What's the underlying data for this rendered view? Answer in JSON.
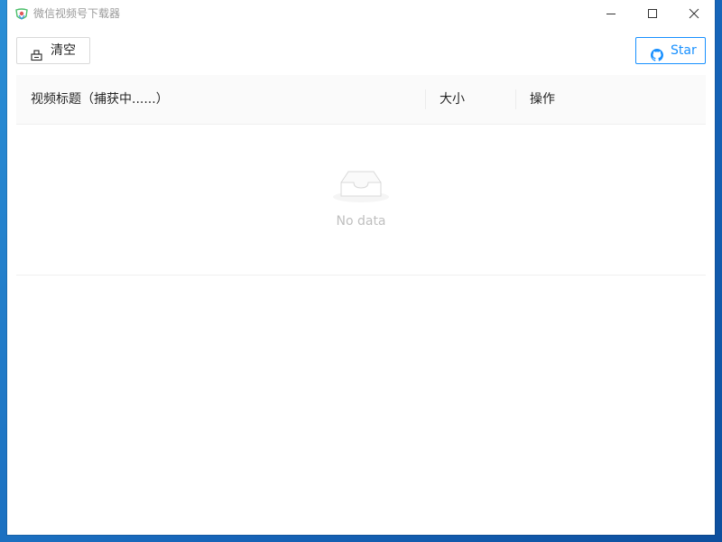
{
  "window": {
    "title": "微信视频号下载器"
  },
  "toolbar": {
    "clear_label": "清空",
    "star_label": "Star"
  },
  "table": {
    "columns": [
      {
        "label": "视频标题（捕获中......）"
      },
      {
        "label": "大小"
      },
      {
        "label": "操作"
      }
    ],
    "empty_text": "No data"
  },
  "colors": {
    "primary": "#1890ff",
    "border": "#d9d9d9",
    "header_bg": "#fafafa",
    "empty_text": "#bfbfbf"
  },
  "icons": {
    "app": "app-logo-icon",
    "clear": "clear-icon",
    "star": "github-icon",
    "empty": "inbox-empty-icon"
  }
}
